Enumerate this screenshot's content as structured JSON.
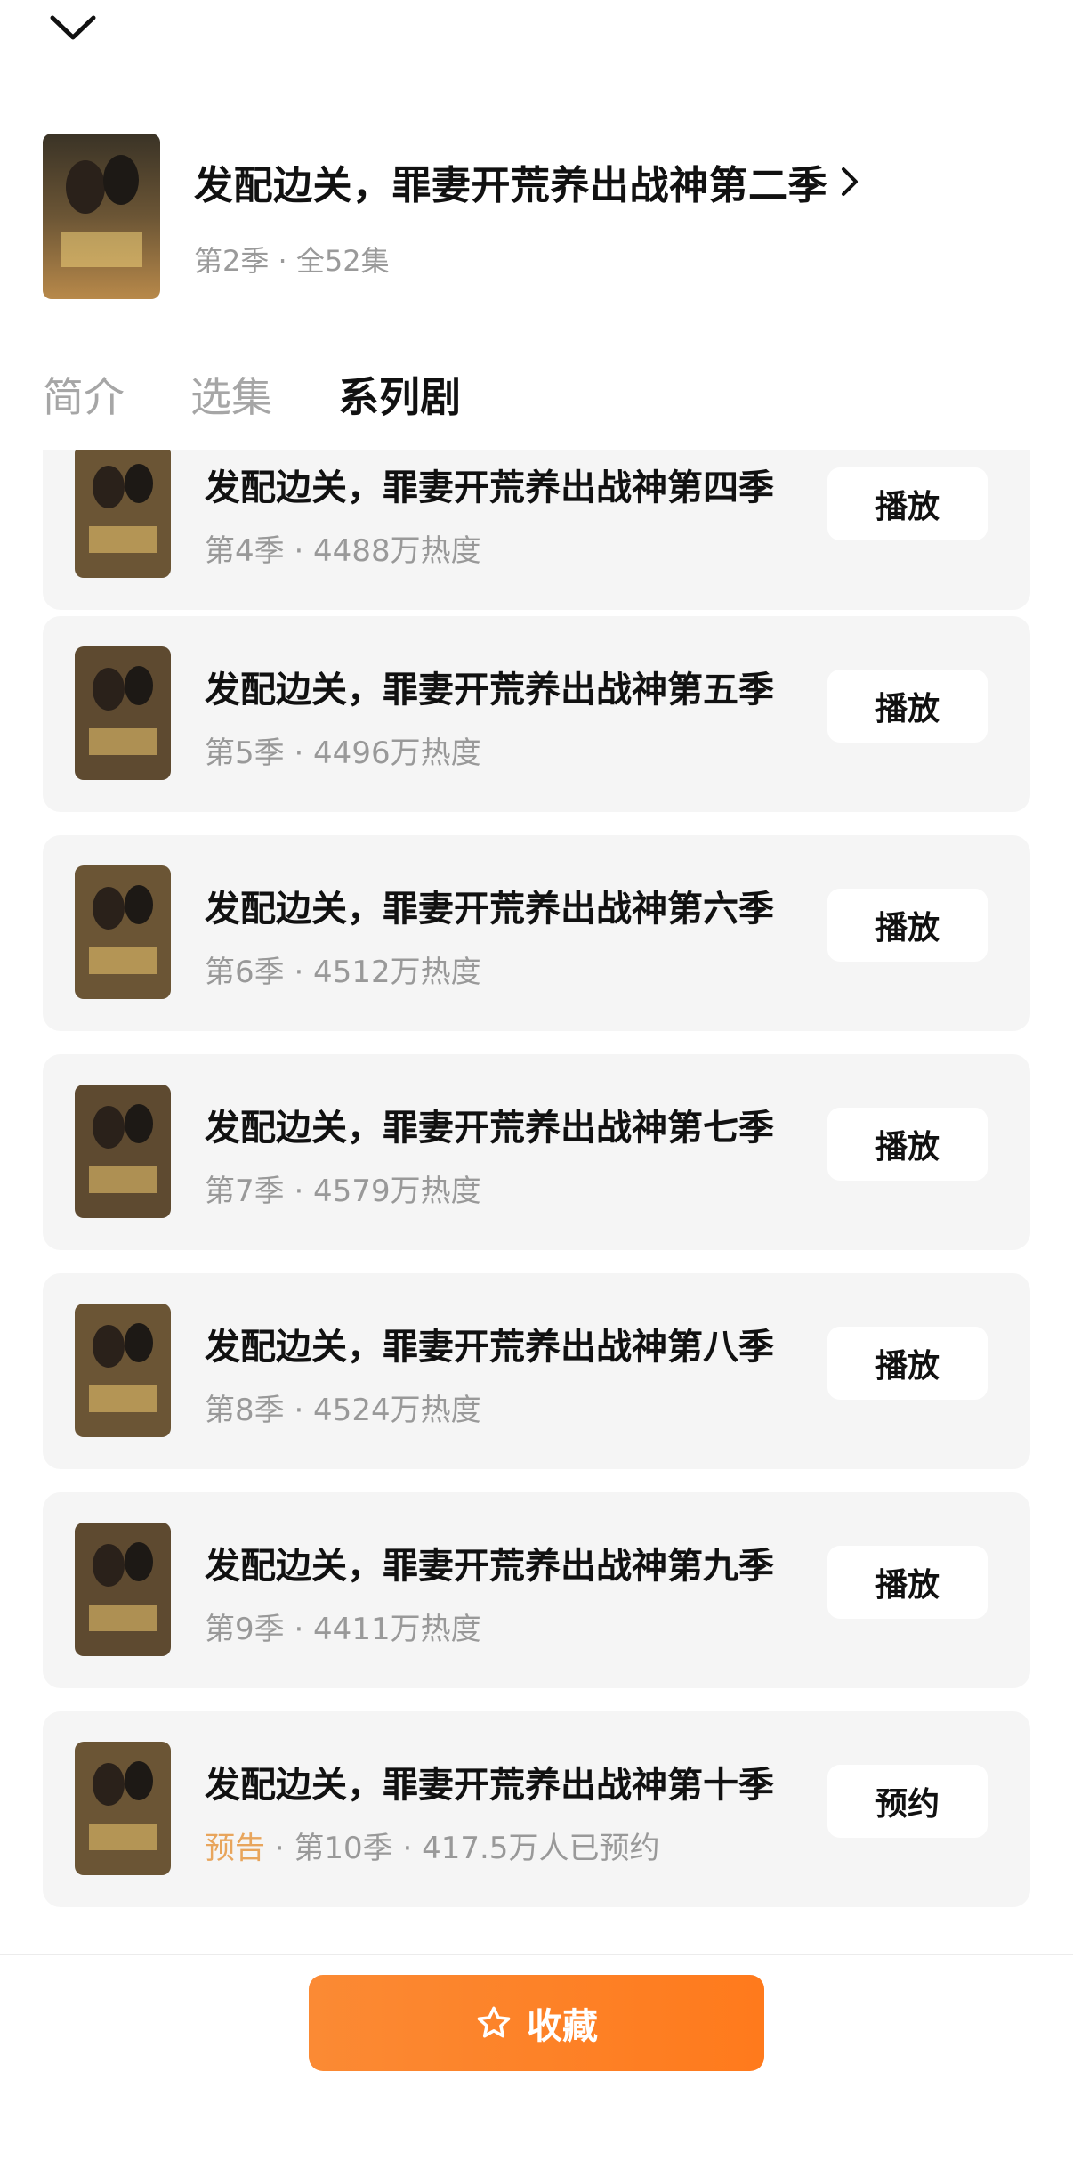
{
  "colors": {
    "accent_orange": "#ff7f24",
    "preview_tag": "#e8a55c",
    "card_bg": "#f5f5f5",
    "muted_text": "#999999"
  },
  "top": {
    "collapse_icon": "chevron-down-icon"
  },
  "header": {
    "title": "发配边关，罪妻开荒养出战神第二季",
    "meta": "第2季 · 全52集",
    "chevron_icon": "chevron-right-icon"
  },
  "tabs": [
    {
      "label": "简介",
      "active": false
    },
    {
      "label": "选集",
      "active": false
    },
    {
      "label": "系列剧",
      "active": true
    }
  ],
  "series": [
    {
      "title": "发配边关，罪妻开荒养出战神第四季",
      "tag": "",
      "meta": "第4季 · 4488万热度",
      "button": "播放"
    },
    {
      "title": "发配边关，罪妻开荒养出战神第五季",
      "tag": "",
      "meta": "第5季 · 4496万热度",
      "button": "播放"
    },
    {
      "title": "发配边关，罪妻开荒养出战神第六季",
      "tag": "",
      "meta": "第6季 · 4512万热度",
      "button": "播放"
    },
    {
      "title": "发配边关，罪妻开荒养出战神第七季",
      "tag": "",
      "meta": "第7季 · 4579万热度",
      "button": "播放"
    },
    {
      "title": "发配边关，罪妻开荒养出战神第八季",
      "tag": "",
      "meta": "第8季 · 4524万热度",
      "button": "播放"
    },
    {
      "title": "发配边关，罪妻开荒养出战神第九季",
      "tag": "",
      "meta": "第9季 · 4411万热度",
      "button": "播放"
    },
    {
      "title": "发配边关，罪妻开荒养出战神第十季",
      "tag": "预告",
      "meta": " · 第10季 · 417.5万人已预约",
      "button": "预约"
    }
  ],
  "bottom": {
    "favorite_label": "收藏",
    "favorite_icon": "star-outline-icon"
  }
}
